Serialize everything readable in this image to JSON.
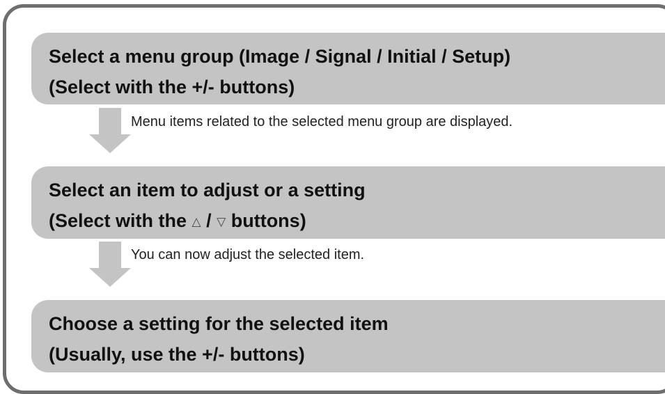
{
  "steps": [
    {
      "line1": "Select a menu group (Image / Signal / Initial / Setup)",
      "line2": "(Select with the +/- buttons)"
    },
    {
      "line1": "Select an item to adjust or a setting",
      "line2_prefix": "(Select with the ",
      "line2_up": "△",
      "line2_sep": " / ",
      "line2_down": "▽",
      "line2_suffix": " buttons)"
    },
    {
      "line1": "Choose a setting for the selected item",
      "line2": "(Usually, use the +/- buttons)"
    }
  ],
  "notes": [
    "Menu items related to the selected menu group are displayed.",
    "You can now adjust the selected item."
  ],
  "colors": {
    "frame_border": "#6e6e6e",
    "box_fill": "#c4c4c4",
    "arrow_fill": "#c4c4c4",
    "text": "#111111"
  },
  "icons": {
    "up_button": "triangle-up-outline",
    "down_button": "triangle-down-outline",
    "flow_arrow": "down-arrow"
  }
}
